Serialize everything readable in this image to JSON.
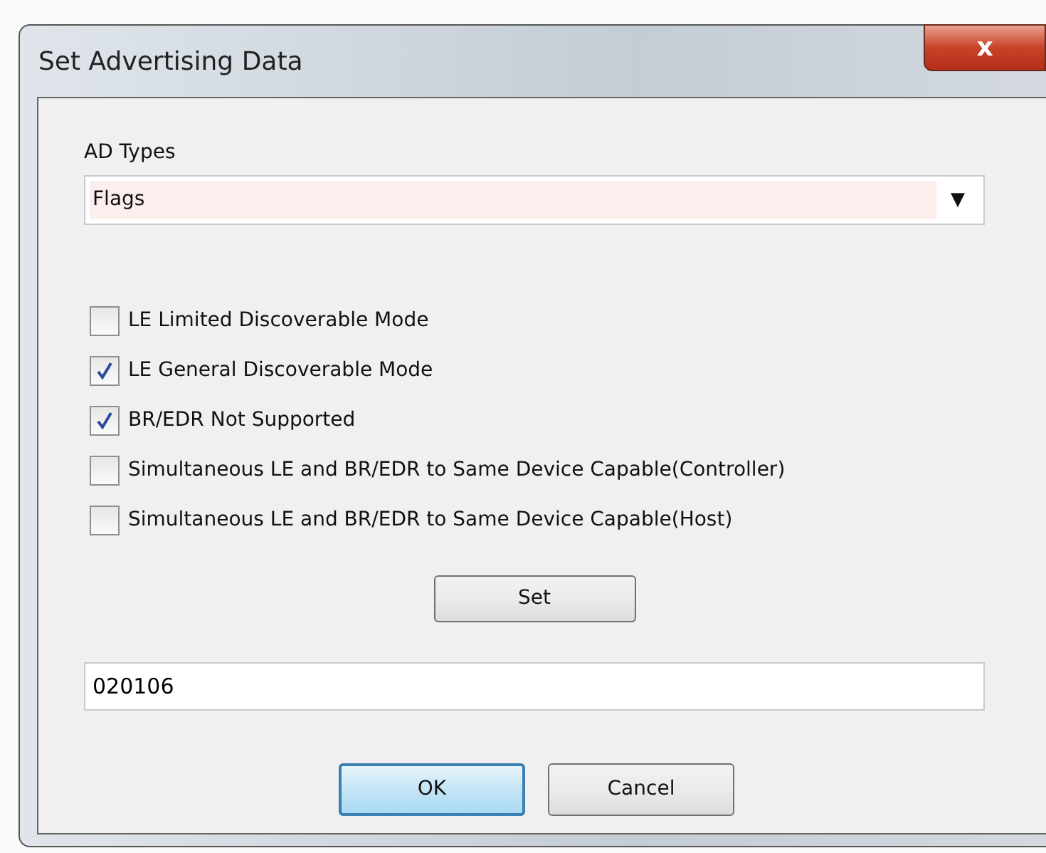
{
  "window": {
    "title": "Set Advertising Data",
    "close": "x"
  },
  "ad_types": {
    "label": "AD Types",
    "value": "Flags",
    "arrow": "▼"
  },
  "flags": [
    {
      "label": "LE Limited Discoverable Mode",
      "checked": false
    },
    {
      "label": "LE General Discoverable Mode",
      "checked": true
    },
    {
      "label": "BR/EDR Not Supported",
      "checked": true
    },
    {
      "label": "Simultaneous LE and BR/EDR to Same Device Capable(Controller)",
      "checked": false
    },
    {
      "label": "Simultaneous LE and BR/EDR to Same Device Capable(Host)",
      "checked": false
    }
  ],
  "set_button": "Set",
  "data_field": {
    "value": "020106"
  },
  "buttons": [
    {
      "label": "OK",
      "default": true
    },
    {
      "label": "Cancel",
      "default": false
    }
  ]
}
